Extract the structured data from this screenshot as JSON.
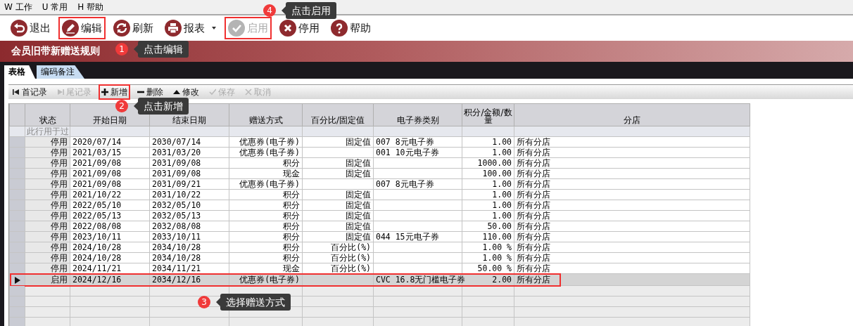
{
  "menu": [
    {
      "key": "W",
      "label": "工作"
    },
    {
      "key": "U",
      "label": "常用"
    },
    {
      "key": "H",
      "label": "帮助"
    }
  ],
  "toolbar": [
    {
      "kind": "exit",
      "label": "退出",
      "disabled": false,
      "highlighted": false
    },
    {
      "kind": "edit",
      "label": "编辑",
      "disabled": false,
      "highlighted": true
    },
    {
      "kind": "refresh",
      "label": "刷新",
      "disabled": false,
      "highlighted": false
    },
    {
      "kind": "report",
      "label": "报表",
      "disabled": false,
      "highlighted": false,
      "dropdown": true
    },
    {
      "kind": "enable",
      "label": "启用",
      "disabled": true,
      "highlighted": true
    },
    {
      "kind": "disable",
      "label": "停用",
      "disabled": false,
      "highlighted": false
    },
    {
      "kind": "help",
      "label": "帮助",
      "disabled": false,
      "highlighted": false
    }
  ],
  "title": "会员旧带新赠送规则",
  "tabs": [
    {
      "label": "表格",
      "selected": true
    },
    {
      "label": "编码备注",
      "selected": false
    }
  ],
  "grid_toolbar": [
    {
      "kind": "first",
      "label": "首记录",
      "disabled": false,
      "highlighted": false
    },
    {
      "kind": "last",
      "label": "尾记录",
      "disabled": true,
      "highlighted": false
    },
    {
      "kind": "add",
      "label": "新增",
      "disabled": false,
      "highlighted": true
    },
    {
      "kind": "delete",
      "label": "删除",
      "disabled": false,
      "highlighted": false
    },
    {
      "kind": "modify",
      "label": "修改",
      "disabled": false,
      "highlighted": false
    },
    {
      "kind": "save",
      "label": "保存",
      "disabled": true,
      "highlighted": false
    },
    {
      "kind": "cancel",
      "label": "取消",
      "disabled": true,
      "highlighted": false
    }
  ],
  "table": {
    "columns": [
      "状态",
      "开始日期",
      "结束日期",
      "赠送方式",
      "百分比/固定值",
      "电子券类别",
      "积分/金额/数量",
      "分店"
    ],
    "filter_row": {
      "placeholder": "此行用于过"
    },
    "rows": [
      {
        "cells": [
          "停用",
          "2020/07/14",
          "2030/07/14",
          "优惠券(电子券)",
          "固定值",
          "007 8元电子券",
          "1.00",
          "所有分店"
        ],
        "selected": false,
        "highlighted": false
      },
      {
        "cells": [
          "停用",
          "2021/03/15",
          "2031/03/20",
          "优惠券(电子券)",
          "",
          "001 10元电子券",
          "1.00",
          "所有分店"
        ],
        "selected": false,
        "highlighted": false
      },
      {
        "cells": [
          "停用",
          "2021/09/08",
          "2031/09/08",
          "积分",
          "固定值",
          "",
          "1000.00",
          "所有分店"
        ],
        "selected": false,
        "highlighted": false
      },
      {
        "cells": [
          "停用",
          "2021/09/08",
          "2031/09/08",
          "现金",
          "固定值",
          "",
          "100.00",
          "所有分店"
        ],
        "selected": false,
        "highlighted": false
      },
      {
        "cells": [
          "停用",
          "2021/09/08",
          "2031/09/21",
          "优惠券(电子券)",
          "",
          "007 8元电子券",
          "1.00",
          "所有分店"
        ],
        "selected": false,
        "highlighted": false
      },
      {
        "cells": [
          "停用",
          "2021/10/22",
          "2031/10/22",
          "积分",
          "固定值",
          "",
          "1.00",
          "所有分店"
        ],
        "selected": false,
        "highlighted": false
      },
      {
        "cells": [
          "停用",
          "2022/05/10",
          "2032/05/10",
          "积分",
          "固定值",
          "",
          "1.00",
          "所有分店"
        ],
        "selected": false,
        "highlighted": false
      },
      {
        "cells": [
          "停用",
          "2022/05/13",
          "2032/05/13",
          "积分",
          "固定值",
          "",
          "1.00",
          "所有分店"
        ],
        "selected": false,
        "highlighted": false
      },
      {
        "cells": [
          "停用",
          "2022/08/08",
          "2032/08/08",
          "积分",
          "固定值",
          "",
          "50.00",
          "所有分店"
        ],
        "selected": false,
        "highlighted": false
      },
      {
        "cells": [
          "停用",
          "2023/10/11",
          "2033/10/11",
          "积分",
          "固定值",
          "044 15元电子券",
          "110.00",
          "所有分店"
        ],
        "selected": false,
        "highlighted": false
      },
      {
        "cells": [
          "停用",
          "2024/10/28",
          "2034/10/28",
          "积分",
          "百分比(%)",
          "",
          "1.00 %",
          "所有分店"
        ],
        "selected": false,
        "highlighted": false
      },
      {
        "cells": [
          "停用",
          "2024/10/28",
          "2034/10/28",
          "积分",
          "百分比(%)",
          "",
          "1.00 %",
          "所有分店"
        ],
        "selected": false,
        "highlighted": false
      },
      {
        "cells": [
          "停用",
          "2024/11/21",
          "2034/11/21",
          "现金",
          "百分比(%)",
          "",
          "50.00 %",
          "所有分店"
        ],
        "selected": false,
        "highlighted": false
      },
      {
        "cells": [
          "启用",
          "2024/12/16",
          "2034/12/16",
          "优惠券(电子券)",
          "",
          "CVC 16.8无门槛电子券",
          "2.00",
          "所有分店"
        ],
        "selected": true,
        "highlighted": true
      }
    ]
  },
  "callouts": [
    {
      "number": "1",
      "text": "点击编辑"
    },
    {
      "number": "2",
      "text": "点击新增"
    },
    {
      "number": "3",
      "text": "选择赠送方式"
    },
    {
      "number": "4",
      "text": "点击启用"
    }
  ]
}
